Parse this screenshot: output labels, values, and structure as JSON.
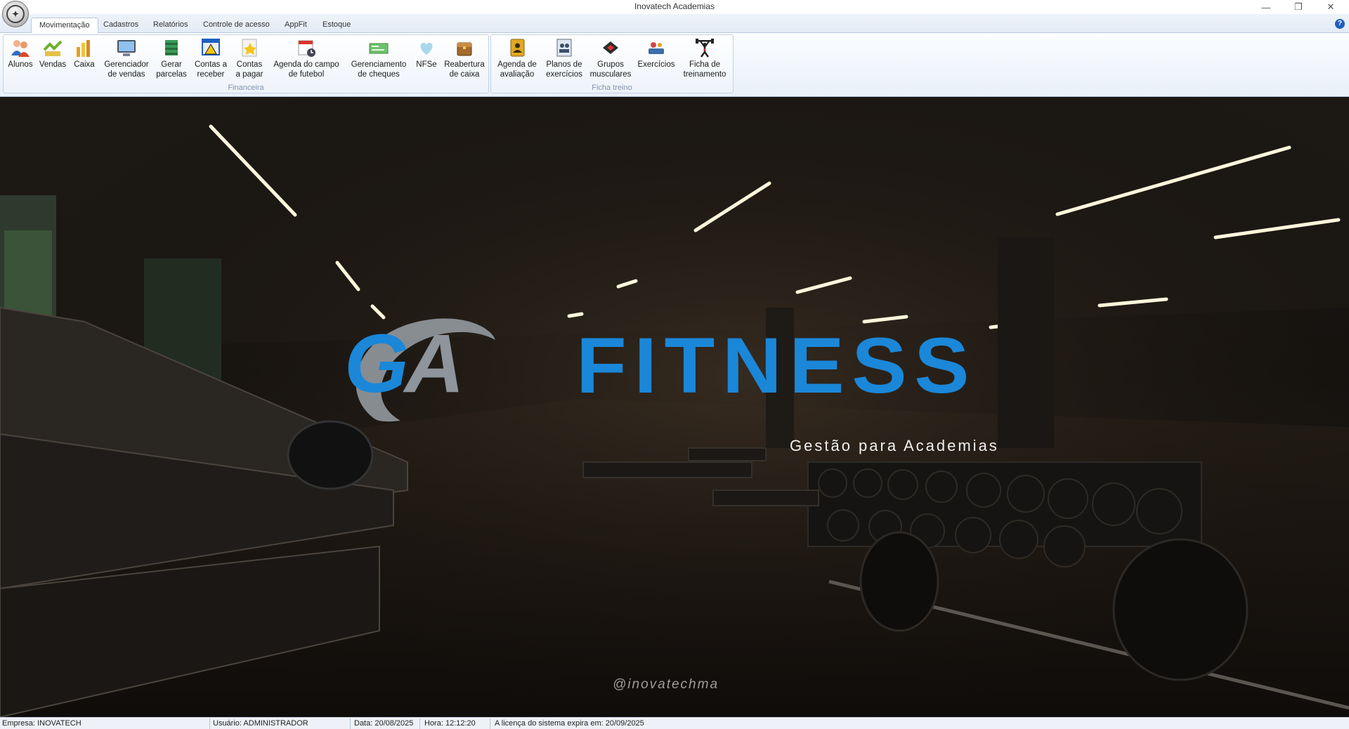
{
  "window": {
    "title": "Inovatech Academias"
  },
  "tabs": [
    {
      "label": "Movimentação",
      "active": true
    },
    {
      "label": "Cadastros"
    },
    {
      "label": "Relatórios"
    },
    {
      "label": "Controle de acesso"
    },
    {
      "label": "AppFit"
    },
    {
      "label": "Estoque"
    }
  ],
  "ribbon": {
    "groups": [
      {
        "label": "Financeira",
        "buttons": [
          {
            "label": "Alunos",
            "icon": "students-icon"
          },
          {
            "label": "Vendas",
            "icon": "sales-icon"
          },
          {
            "label": "Caixa",
            "icon": "cash-icon"
          },
          {
            "label": "Gerenciador\nde vendas",
            "icon": "monitor-icon"
          },
          {
            "label": "Gerar\nparcelas",
            "icon": "money-stack-icon"
          },
          {
            "label": "Contas a\nreceber",
            "icon": "warning-window-icon"
          },
          {
            "label": "Contas\na pagar",
            "icon": "star-document-icon"
          },
          {
            "label": "Agenda do campo\nde futebol",
            "icon": "calendar-clock-icon"
          },
          {
            "label": "Gerenciamento\nde cheques",
            "icon": "check-icon"
          },
          {
            "label": "NFSe",
            "icon": "heart-ribbon-icon"
          },
          {
            "label": "Reabertura\nde caixa",
            "icon": "chest-icon"
          }
        ]
      },
      {
        "label": "Ficha treino",
        "buttons": [
          {
            "label": "Agenda de\navaliação",
            "icon": "contact-book-icon"
          },
          {
            "label": "Planos de\nexercícios",
            "icon": "plan-group-icon"
          },
          {
            "label": "Grupos\nmusculares",
            "icon": "muscle-group-icon"
          },
          {
            "label": "Exercícios",
            "icon": "exercise-icon"
          },
          {
            "label": "Ficha de\ntreinamento",
            "icon": "weightlifter-icon"
          }
        ]
      }
    ]
  },
  "hero": {
    "logo_ga_first": "G",
    "logo_ga_second": "A",
    "logo_word": "FITNESS",
    "logo_subtitle": "Gestão para Academias",
    "social_handle": "@inovatechma",
    "colors": {
      "brand_blue": "#1b87d8",
      "brand_gray": "#8e959c"
    }
  },
  "status": {
    "company": "Empresa: INOVATECH",
    "user": "Usuário: ADMINISTRADOR",
    "date": "Data: 20/08/2025",
    "time": "Hora: 12:12:20",
    "license": "A licença do sistema expira em: 20/09/2025"
  }
}
